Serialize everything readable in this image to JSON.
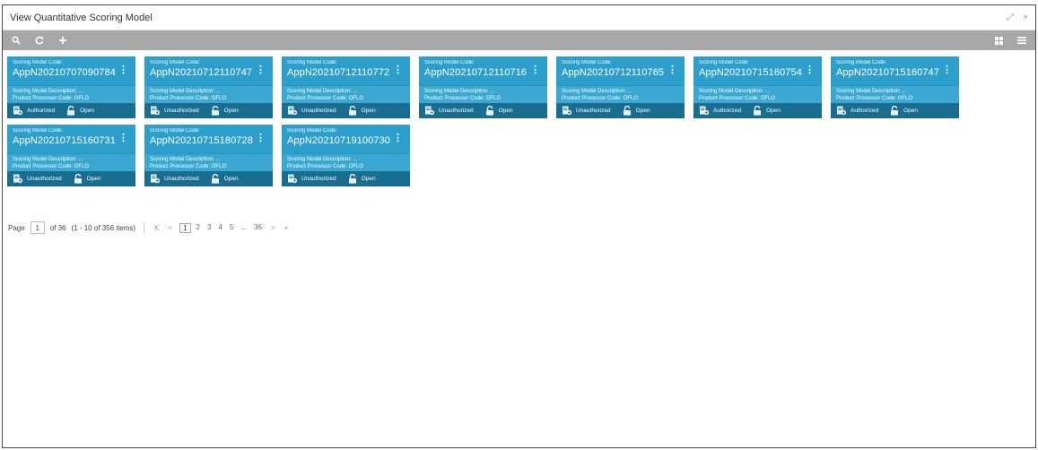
{
  "window": {
    "title": "View Quantitative Scoring Model",
    "maximize_glyph": "⤢",
    "close_glyph": "×"
  },
  "toolbar": {
    "search_icon": "search-icon",
    "refresh_icon": "refresh-icon",
    "add_icon": "plus-icon",
    "grid_view_icon": "tile-view-icon",
    "list_view_icon": "list-view-icon"
  },
  "card_labels": {
    "code_label": "Scoring Model Code:",
    "description": "Scoring Model Description: ...",
    "processor": "Product Processor Code: OFLO",
    "open": "Open"
  },
  "cards": [
    {
      "code": "AppN20210707090784",
      "status": "Authorized"
    },
    {
      "code": "AppN20210712110747",
      "status": "Unauthorized"
    },
    {
      "code": "AppN20210712110772",
      "status": "Unauthorized"
    },
    {
      "code": "AppN20210712110716",
      "status": "Unauthorized"
    },
    {
      "code": "AppN20210712110765",
      "status": "Unauthorized"
    },
    {
      "code": "AppN20210715160754",
      "status": "Authorized"
    },
    {
      "code": "AppN20210715160747",
      "status": "Authorized"
    },
    {
      "code": "AppN20210715160731",
      "status": "Unauthorized"
    },
    {
      "code": "AppN20210715180728",
      "status": "Unauthorized"
    },
    {
      "code": "AppN20210719100730",
      "status": "Unauthorized"
    }
  ],
  "pager": {
    "page_label": "Page",
    "current_page": "1",
    "of_text": "of 36",
    "range_text": "(1 - 10 of 356 items)",
    "first": "K",
    "prev": "<",
    "pages": [
      "1",
      "2",
      "3",
      "4",
      "5",
      "...",
      "36"
    ],
    "next": ">",
    "last": "×"
  },
  "colors": {
    "card_top": "#2d9fcd",
    "card_bottom": "#186d90",
    "toolbar": "#a7a7a7"
  }
}
